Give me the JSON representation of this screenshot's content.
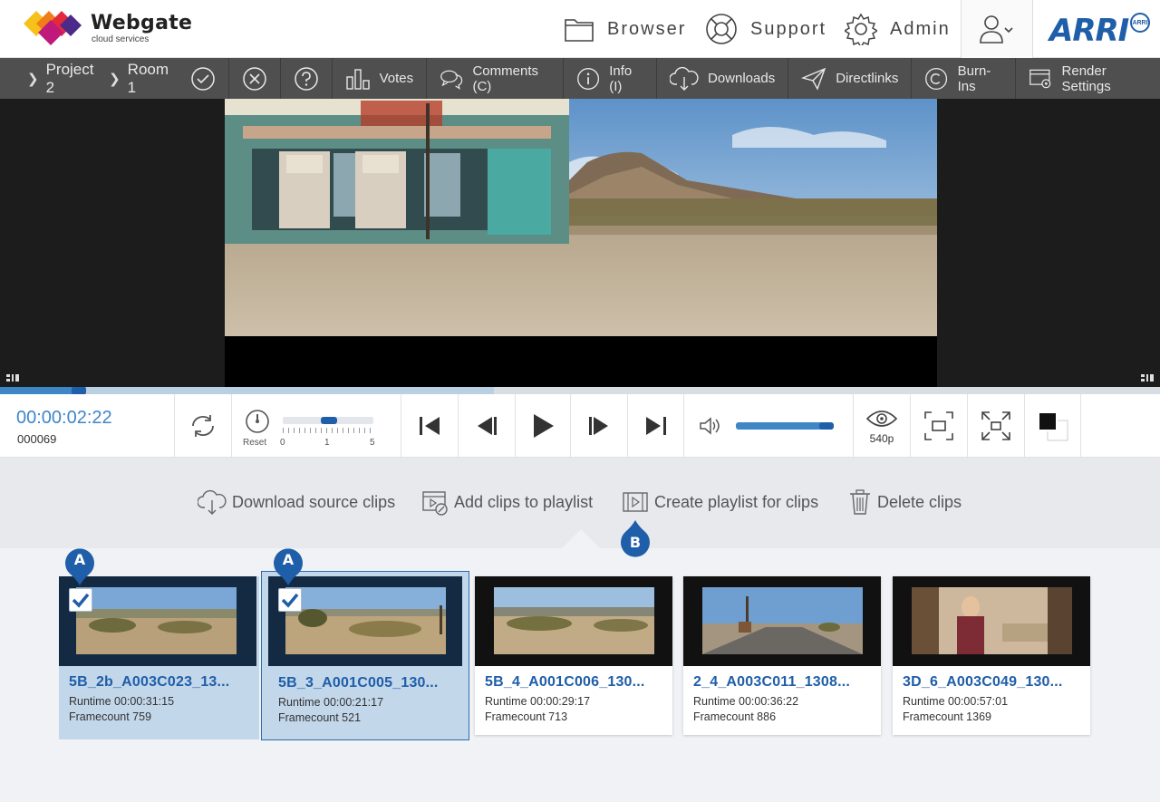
{
  "app": {
    "logo_title": "Webgate",
    "logo_subtitle": "cloud services",
    "brand": "ARRI",
    "brand_badge": "ARRI"
  },
  "topnav": {
    "browser": "Browser",
    "support": "Support",
    "admin": "Admin"
  },
  "breadcrumb": [
    "Project 2",
    "Room 1"
  ],
  "toolbar": {
    "votes": "Votes",
    "comments": "Comments (C)",
    "info": "Info (I)",
    "downloads": "Downloads",
    "directlinks": "Directlinks",
    "burnins": "Burn-Ins",
    "render": "Render Settings"
  },
  "player": {
    "timecode": "00:00:02:22",
    "frame": "000069",
    "reset_label": "Reset",
    "speed_ticks": [
      "0",
      "1",
      "5"
    ],
    "quality": "540p",
    "progress_fraction": 0.068,
    "buffer_fraction": 0.426,
    "speed_fraction": 0.51,
    "volume_fraction": 0.93
  },
  "actions": {
    "download": "Download source clips",
    "add_playlist": "Add clips to playlist",
    "create_playlist": "Create playlist for clips",
    "delete": "Delete clips"
  },
  "markers": {
    "a": "A",
    "b": "B"
  },
  "clips": [
    {
      "title": "5B_2b_A003C023_13...",
      "runtime": "Runtime 00:00:31:15",
      "framecount": "Framecount 759",
      "selected": true
    },
    {
      "title": "5B_3_A001C005_130...",
      "runtime": "Runtime 00:00:21:17",
      "framecount": "Framecount 521",
      "selected": true
    },
    {
      "title": "5B_4_A001C006_130...",
      "runtime": "Runtime 00:00:29:17",
      "framecount": "Framecount 713",
      "selected": false
    },
    {
      "title": "2_4_A003C011_1308...",
      "runtime": "Runtime 00:00:36:22",
      "framecount": "Framecount 886",
      "selected": false
    },
    {
      "title": "3D_6_A003C049_130...",
      "runtime": "Runtime 00:00:57:01",
      "framecount": "Framecount 1369",
      "selected": false
    }
  ],
  "colors": {
    "accent": "#1f5ea8",
    "accent_light": "#3f86c7",
    "toolbar": "#4f4f4f",
    "selected_clip": "#c3d7ea"
  }
}
